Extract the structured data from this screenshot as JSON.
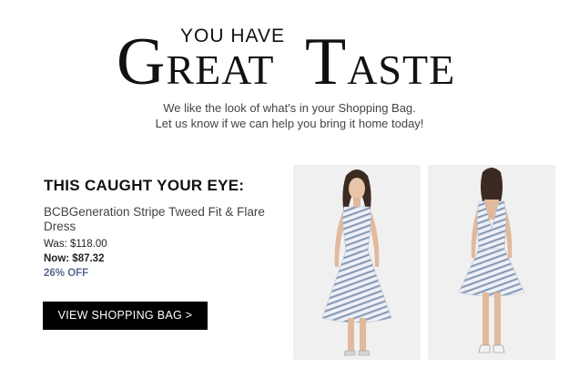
{
  "hero": {
    "you_have": "YOU HAVE",
    "word1_cap": "G",
    "word1_rest": "REAT",
    "word2_cap": "T",
    "word2_rest": "ASTE"
  },
  "intro": {
    "line1": "We like the look of what's in your Shopping Bag.",
    "line2": "Let us know if we can help you bring it home today!"
  },
  "product": {
    "heading": "THIS CAUGHT YOUR EYE:",
    "name": "BCBGeneration Stripe Tweed Fit & Flare Dress",
    "was": "Was: $118.00",
    "now": "Now: $87.32",
    "discount": "26% OFF",
    "button_label": "VIEW SHOPPING BAG >"
  },
  "images": [
    {
      "name": "product-image-front",
      "icon": "dress-front-photo"
    },
    {
      "name": "product-image-back",
      "icon": "dress-back-photo"
    }
  ],
  "colors": {
    "button_bg": "#000000",
    "button_text": "#ffffff",
    "discount_text": "#5a6a8e",
    "photo_bg": "#f0f0f0"
  }
}
